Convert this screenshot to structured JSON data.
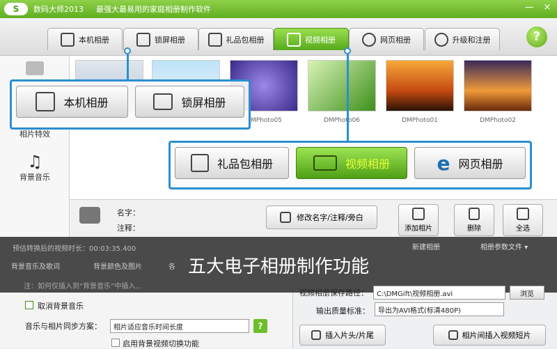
{
  "window": {
    "logo": "S",
    "app_name": "数码大师2013",
    "slogan": "最强大最易用的家庭相册制作软件",
    "minimize": "—",
    "close": "×"
  },
  "tabs": [
    {
      "label": "本机相册"
    },
    {
      "label": "锁屏相册"
    },
    {
      "label": "礼品包相册"
    },
    {
      "label": "视频相册"
    },
    {
      "label": "网页相册"
    },
    {
      "label": "升级和注册"
    }
  ],
  "help_button": "?",
  "left_panel": {
    "effects_label": "相片特效",
    "music_label": "背景音乐"
  },
  "photos": [
    {
      "caption": ""
    },
    {
      "caption": ""
    },
    {
      "caption": "DMPhoto05"
    },
    {
      "caption": "DMPhoto06"
    },
    {
      "caption": "DMPhoto01"
    },
    {
      "caption": "DMPhoto02"
    }
  ],
  "callout_top": [
    {
      "label": "本机相册"
    },
    {
      "label": "锁屏相册"
    }
  ],
  "callout_bottom": [
    {
      "label": "礼品包相册"
    },
    {
      "label": "视频相册"
    },
    {
      "label": "网页相册"
    }
  ],
  "info": {
    "name_label": "名字：",
    "note_label": "注释：",
    "edit_button": "修改名字/注释/旁白",
    "add_photo": "添加相片",
    "delete": "删除",
    "select_all": "全选"
  },
  "banner": {
    "overlay_title": "五大电子相册制作功能",
    "total_length": "预估转换后的视频时长：00:03:35.400",
    "new_album": "新建相册",
    "album_settings": "相册参数文件 ▾"
  },
  "bottom_tabs": [
    "背景音乐及歌词",
    "背景颜色及图片",
    "各"
  ],
  "bottom": {
    "hint": "注：如何仅插入到“背景音乐”中插入...",
    "cancel_music": "取消背景音乐",
    "sync_label": "音乐与相片同步方案：",
    "sync_value": "相片适应音乐时间长度",
    "enable_switch": "启用背景视频切换功能",
    "save_path_label": "视频相册保存路径：",
    "save_path_value": "C:\\DMGift\\视频相册.avi",
    "browse": "浏览",
    "quality_label": "输出质量标准：",
    "quality_value": "导出为AVI格式(标清480P)",
    "insert_head": "插入片头/片尾",
    "insert_video": "相片间插入视频短片"
  },
  "colors": {
    "accent_green": "#5fae1f",
    "callout_blue": "#2b8fd0",
    "active_text": "#e8ff3a"
  }
}
